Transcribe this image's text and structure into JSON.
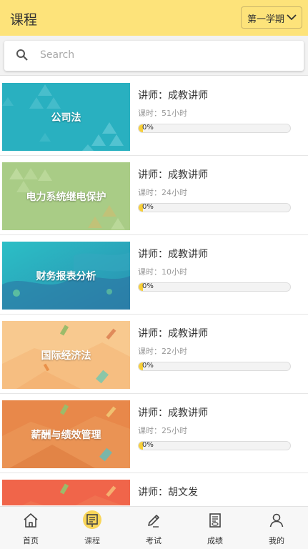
{
  "header": {
    "title": "课程",
    "term": "第一学期"
  },
  "search": {
    "placeholder": "Search"
  },
  "courses": [
    {
      "name": "公司法",
      "teacher": "讲师：成教讲师",
      "hours": "课时：51小时",
      "progress": "0%",
      "progress_value": 0,
      "theme": "teal"
    },
    {
      "name": "电力系统继电保护",
      "teacher": "讲师：成教讲师",
      "hours": "课时：24小时",
      "progress": "0%",
      "progress_value": 0,
      "theme": "green"
    },
    {
      "name": "财务报表分析",
      "teacher": "讲师：成教讲师",
      "hours": "课时：10小时",
      "progress": "0%",
      "progress_value": 0,
      "theme": "blue"
    },
    {
      "name": "国际经济法",
      "teacher": "讲师：成教讲师",
      "hours": "课时：22小时",
      "progress": "0%",
      "progress_value": 0,
      "theme": "peach"
    },
    {
      "name": "薪酬与绩效管理",
      "teacher": "讲师：成教讲师",
      "hours": "课时：25小时",
      "progress": "0%",
      "progress_value": 0,
      "theme": "orange"
    },
    {
      "name": "",
      "teacher": "讲师：胡文发",
      "hours": "",
      "progress": "",
      "progress_value": 0,
      "theme": "red"
    }
  ],
  "tabs": [
    {
      "label": "首页",
      "icon": "home-icon"
    },
    {
      "label": "课程",
      "icon": "course-icon",
      "active": true
    },
    {
      "label": "考试",
      "icon": "pencil-icon"
    },
    {
      "label": "成绩",
      "icon": "score-icon"
    },
    {
      "label": "我的",
      "icon": "user-icon"
    }
  ],
  "colors": {
    "header": "#fde37a",
    "accent": "#f7cf3a"
  }
}
